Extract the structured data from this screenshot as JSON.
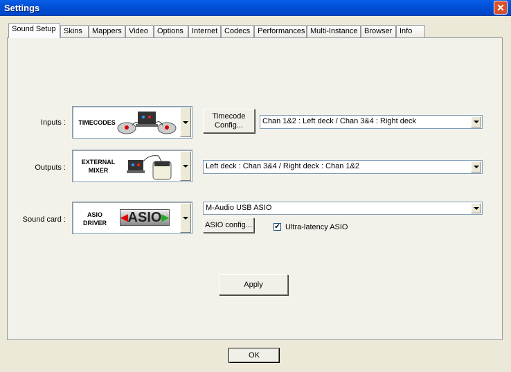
{
  "window": {
    "title": "Settings",
    "close_icon": "close-icon"
  },
  "tabs": [
    "Sound Setup",
    "Skins",
    "Mappers",
    "Video",
    "Options",
    "Internet",
    "Codecs",
    "Performances",
    "Multi-Instance",
    "Browser",
    "Info"
  ],
  "rows": {
    "inputs": {
      "label": "Inputs :",
      "image_text": "TIMECODES",
      "config_button": "Timecode Config...",
      "config_line1": "Timecode",
      "config_line2": "Config...",
      "select": "Chan 1&2 : Left deck / Chan 3&4 : Right deck"
    },
    "outputs": {
      "label": "Outputs :",
      "image_line1": "EXTERNAL",
      "image_line2": "MIXER",
      "select": "Left deck : Chan 3&4 / Right deck : Chan 1&2"
    },
    "soundcard": {
      "label": "Sound card :",
      "image_line1": "ASIO",
      "image_line2": "DRIVER",
      "logo": "ASIO",
      "select": "M-Audio USB ASIO",
      "config_button": "ASIO config...",
      "checkbox_label": "Ultra-latency ASIO",
      "checkbox_checked": true
    }
  },
  "apply": "Apply",
  "ok": "OK"
}
